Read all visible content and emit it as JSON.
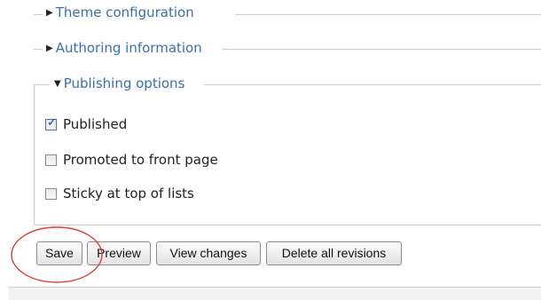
{
  "fieldsets": {
    "theme": {
      "label": "Theme configuration",
      "collapsed": true
    },
    "authoring": {
      "label": "Authoring information",
      "collapsed": true
    },
    "publishing": {
      "label": "Publishing options",
      "collapsed": false
    }
  },
  "publishing_options": [
    {
      "label": "Published",
      "checked": true
    },
    {
      "label": "Promoted to front page",
      "checked": false
    },
    {
      "label": "Sticky at top of lists",
      "checked": false
    }
  ],
  "buttons": {
    "save": "Save",
    "preview": "Preview",
    "view_changes": "View changes",
    "delete_all_revisions": "Delete all revisions"
  },
  "icons": {
    "collapsed": "triangle-right-icon",
    "expanded": "triangle-down-icon",
    "annotation": "red-circle-highlight"
  },
  "colors": {
    "legend_link": "#3a6fb0",
    "annotation": "#e53935",
    "checkbox_check": "#243f8a"
  }
}
